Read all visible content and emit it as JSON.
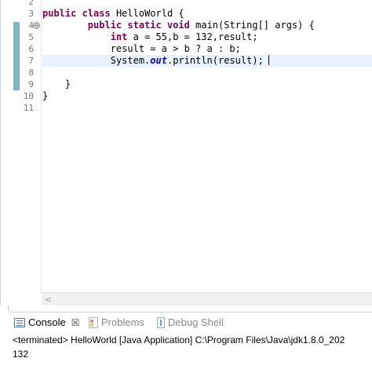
{
  "editor": {
    "line_numbers": [
      "2",
      "3",
      "4",
      "5",
      "6",
      "7",
      "8",
      "9",
      "10",
      "11"
    ],
    "fold_symbol": "⊖",
    "lines": [
      {
        "segments": []
      },
      {
        "segments": [
          {
            "t": "public",
            "k": "kw"
          },
          {
            "t": " "
          },
          {
            "t": "class",
            "k": "kw"
          },
          {
            "t": " HelloWorld {"
          }
        ]
      },
      {
        "segments": [
          {
            "t": "        "
          },
          {
            "t": "public",
            "k": "kw"
          },
          {
            "t": " "
          },
          {
            "t": "static",
            "k": "kw"
          },
          {
            "t": " "
          },
          {
            "t": "void",
            "k": "kw"
          },
          {
            "t": " main(String[] args) {"
          }
        ]
      },
      {
        "segments": [
          {
            "t": "            "
          },
          {
            "t": "int",
            "k": "kw"
          },
          {
            "t": " a = 55,b = 132,result;"
          }
        ]
      },
      {
        "segments": [
          {
            "t": "            result = a > b ? a : b;"
          }
        ]
      },
      {
        "segments": [
          {
            "t": "            System."
          },
          {
            "t": "out",
            "k": "fld"
          },
          {
            "t": ".println(result);"
          }
        ],
        "current": true
      },
      {
        "segments": []
      },
      {
        "segments": [
          {
            "t": "    }"
          }
        ]
      },
      {
        "segments": [
          {
            "t": "}"
          }
        ]
      },
      {
        "segments": []
      }
    ],
    "scroll_left_glyph": "<"
  },
  "console": {
    "tabs": [
      {
        "label": "Console",
        "close": "☒",
        "active": true,
        "icon": "console-icon"
      },
      {
        "label": "Problems",
        "active": false,
        "icon": "problems-icon"
      },
      {
        "label": "Debug Shell",
        "active": false,
        "icon": "debug-shell-icon"
      }
    ],
    "status": "<terminated> HelloWorld [Java Application] C:\\Program Files\\Java\\jdk1.8.0_202",
    "output": "132"
  }
}
